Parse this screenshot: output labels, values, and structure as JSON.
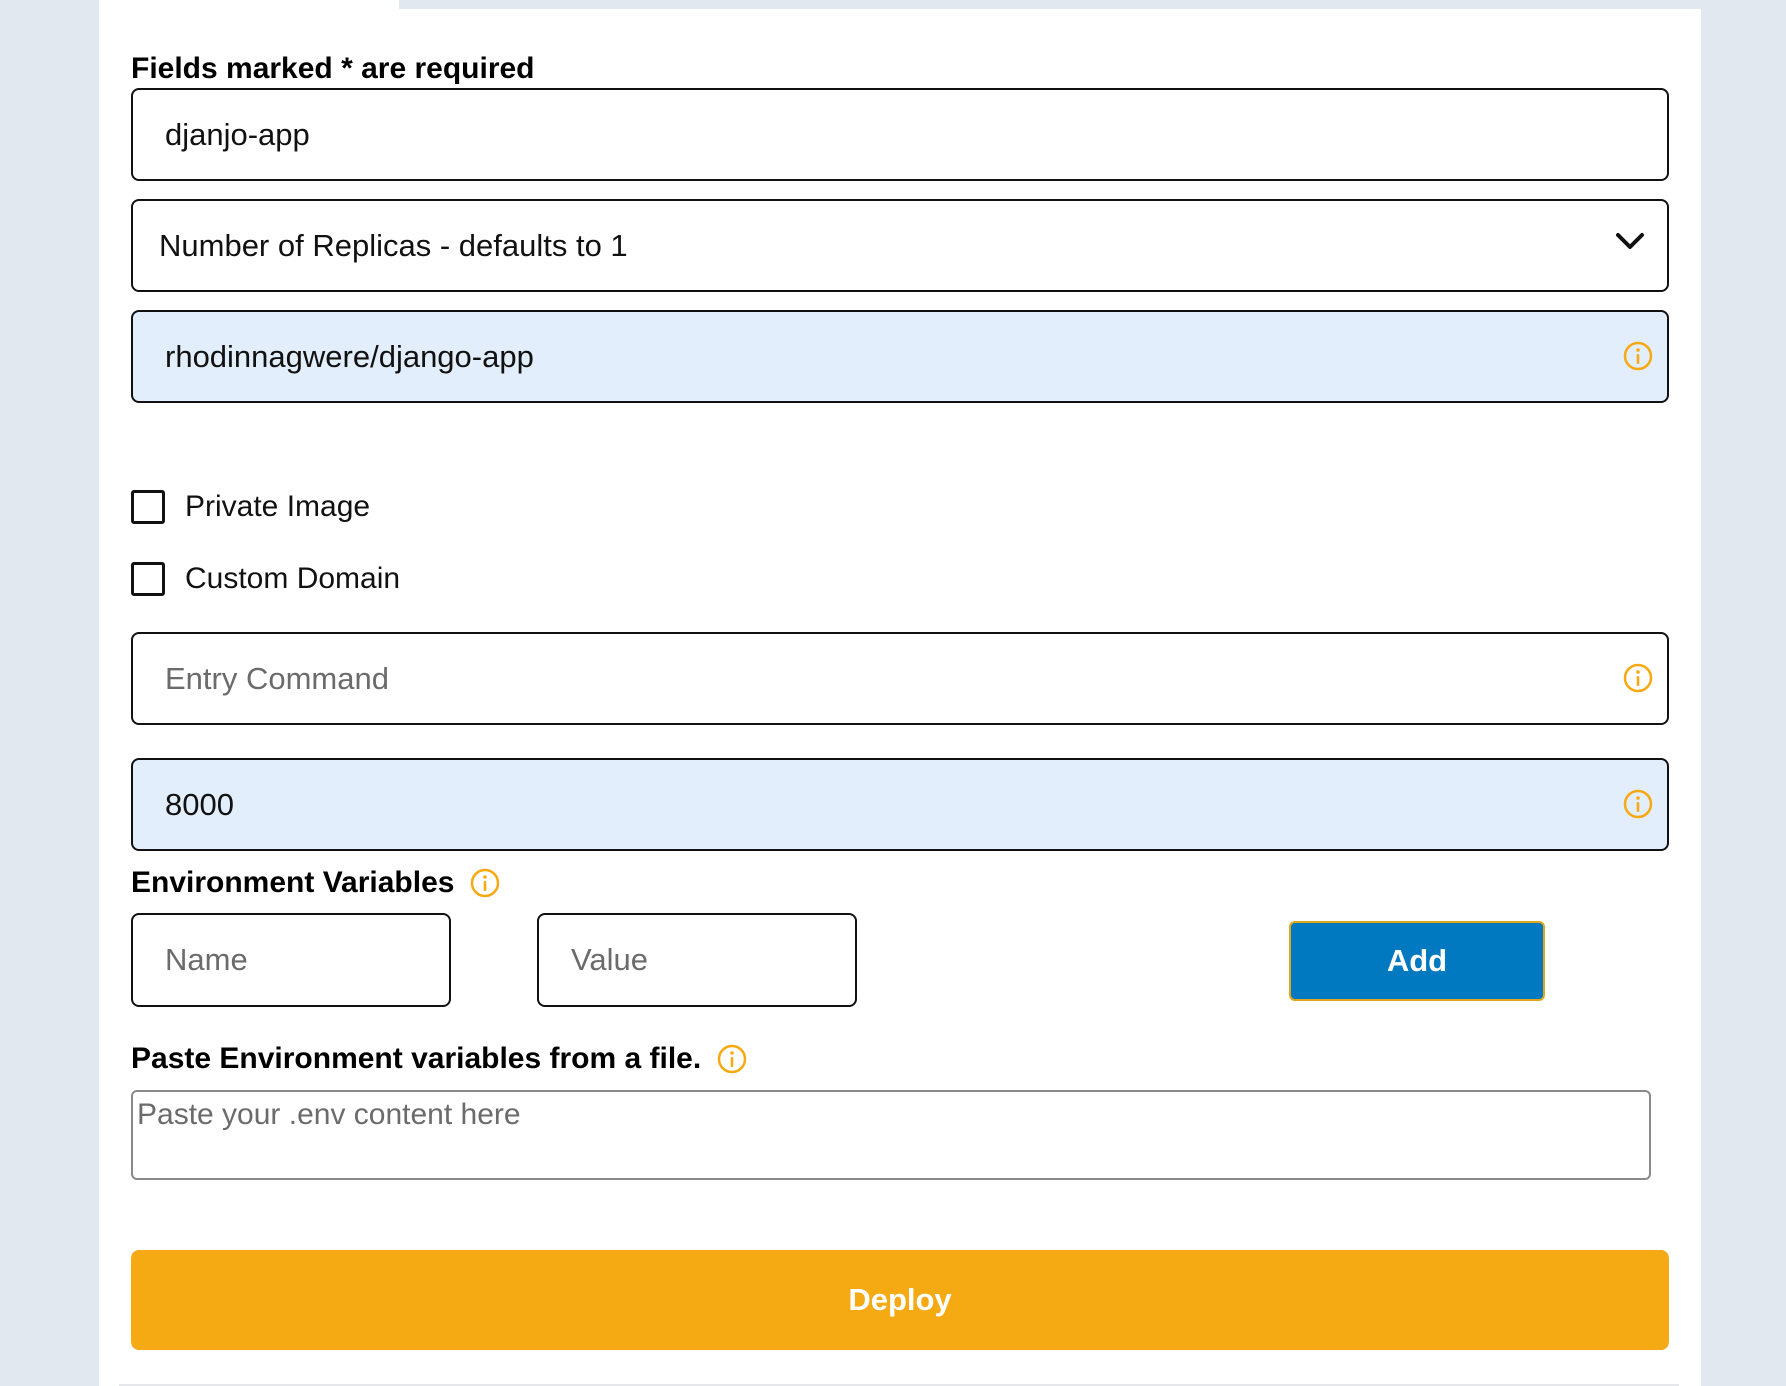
{
  "form": {
    "required_note": "Fields marked * are required",
    "app_name": {
      "value": "djanjo-app"
    },
    "replicas": {
      "selected": "Number of Replicas - defaults to 1"
    },
    "image": {
      "value": "rhodinnagwere/django-app"
    },
    "private_image": {
      "label": "Private Image",
      "checked": false
    },
    "custom_domain": {
      "label": "Custom Domain",
      "checked": false
    },
    "entry_command": {
      "value": "",
      "placeholder": "Entry Command"
    },
    "port": {
      "value": "8000"
    },
    "env_vars": {
      "title": "Environment Variables",
      "name_placeholder": "Name",
      "value_placeholder": "Value",
      "add_label": "Add"
    },
    "env_file": {
      "title": "Paste Environment variables from a file.",
      "placeholder": "Paste your .env content here"
    },
    "deploy_label": "Deploy"
  },
  "colors": {
    "accent_info": "#f5aa13",
    "filled_background": "#e2eefc",
    "add_button": "#0079c1",
    "deploy_button": "#f5aa13"
  },
  "icons": {
    "info": "info-icon",
    "dropdown": "chevron-down-icon"
  }
}
